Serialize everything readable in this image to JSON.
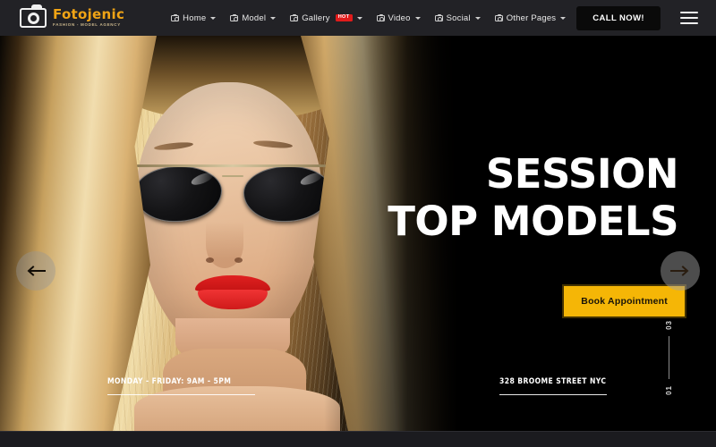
{
  "header": {
    "logo": {
      "title": "Fotojenic",
      "subtitle": "Fashion - Model Agency",
      "icon": "camera-icon"
    },
    "nav": [
      {
        "label": "Home",
        "icon": "camera-icon",
        "caret": true,
        "badge": null
      },
      {
        "label": "Model",
        "icon": "camera-icon",
        "caret": true,
        "badge": null
      },
      {
        "label": "Gallery",
        "icon": "camera-icon",
        "caret": true,
        "badge": "HOT"
      },
      {
        "label": "Video",
        "icon": "camera-icon",
        "caret": true,
        "badge": null
      },
      {
        "label": "Social",
        "icon": "camera-icon",
        "caret": true,
        "badge": null
      },
      {
        "label": "Other Pages",
        "icon": "camera-icon",
        "caret": true,
        "badge": null
      }
    ],
    "call_button": "CALL NOW!",
    "menu_icon": "hamburger-menu-icon"
  },
  "hero": {
    "headline_line1": "SESSION",
    "headline_line2": "TOP MODELS",
    "book_button": "Book Appointment",
    "hours": "MONDAY - FRIDAY: 9AM - 5PM",
    "address": "328 BROOME STREET NYC",
    "slider": {
      "current": "03",
      "total": "01",
      "prev_icon": "arrow-left-icon",
      "next_icon": "arrow-right-icon"
    }
  },
  "colors": {
    "brand_orange": "#f0a415",
    "accent_yellow": "#f5b606",
    "badge_red": "#e11b1b",
    "header_bg": "#222226",
    "hero_bg": "#000000",
    "footer_bg": "#1b1b1f"
  }
}
